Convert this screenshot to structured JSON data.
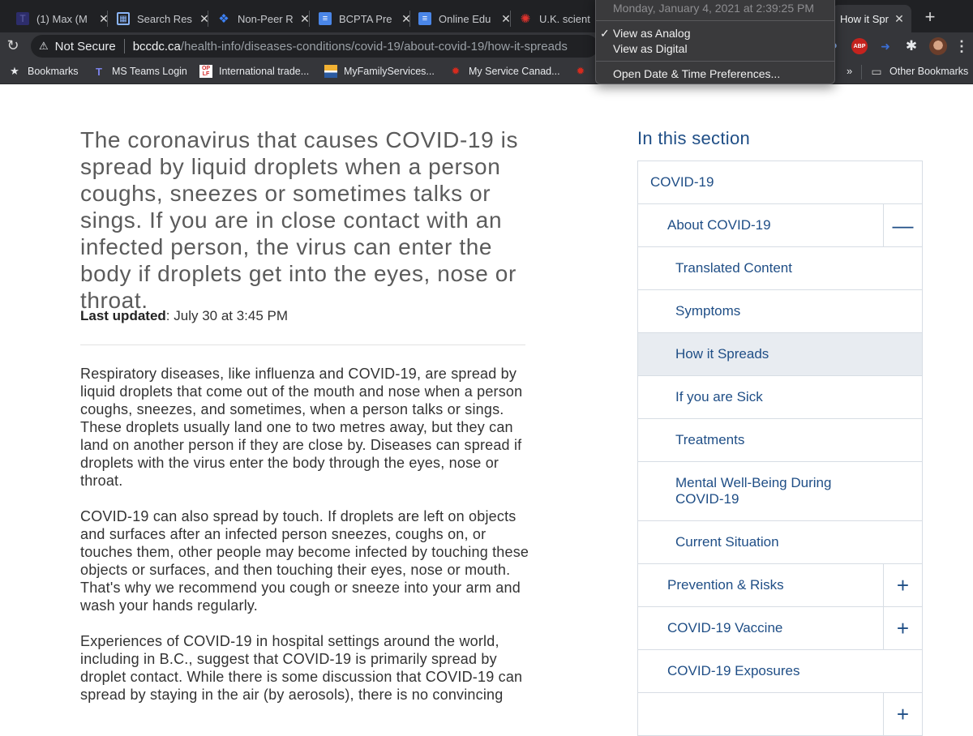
{
  "browser": {
    "tabs": [
      {
        "title": "(1) Max (M",
        "icon": "teams-icon"
      },
      {
        "title": "Search Res",
        "icon": "grid-icon"
      },
      {
        "title": "Non-Peer R",
        "icon": "dropbox-icon"
      },
      {
        "title": "BCPTA Pre",
        "icon": "docs-icon"
      },
      {
        "title": "Online Edu",
        "icon": "docs-icon"
      },
      {
        "title": "U.K. scient",
        "icon": "cbc-icon"
      },
      {
        "title": "How it Spr",
        "icon": "",
        "active": true
      }
    ],
    "new_tab": "+",
    "close": "✕",
    "reload": "↻",
    "address": {
      "security_icon": "⚠",
      "security_label": "Not Secure",
      "host": "bccdc.ca",
      "path": "/health-info/diseases-conditions/covid-19/about-covid-19/how-it-spreads"
    },
    "extensions": {
      "abp_label": "ABP",
      "menu": "⋮"
    },
    "bookmarks": [
      {
        "label": "Bookmarks",
        "icon": "star-icon"
      },
      {
        "label": "MS Teams Login",
        "icon": "teams-icon"
      },
      {
        "label": "International trade...",
        "icon": "oplf-icon"
      },
      {
        "label": "MyFamilyServices...",
        "icon": "bc-icon"
      },
      {
        "label": "My Service Canad...",
        "icon": "maple-leaf-icon"
      }
    ],
    "bookmarks_overflow": "»",
    "other_bookmarks": "Other Bookmarks"
  },
  "clock_menu": {
    "date": "Monday, January 4, 2021 at 2:39:25 PM",
    "items": [
      {
        "label": "View as Analog",
        "checked": true
      },
      {
        "label": "View as Digital",
        "checked": false
      },
      {
        "label": "Open Date & Time Preferences..."
      }
    ],
    "check": "✓"
  },
  "article": {
    "lead": "The coronavirus that causes COVID-19 is spread by liquid droplets when a person coughs, sneezes or sometimes talks or sings. If you are in close contact with an infected person, the virus can enter the body if droplets get into the eyes, nose or throat.",
    "updated_label": "Last updated",
    "updated_value": ": July 30 at 3:45 PM",
    "paragraphs": [
      "Respiratory diseases, like influenza and COVID-19, are spread by liquid droplets that come out of the mouth and nose when a person coughs, sneezes, and sometimes, when a person talks or sings. These droplets usually land one to two metres away, but they can land on another person if they are close by. Diseases can spread if droplets with the virus enter the body through the eyes, nose or throat.",
      "COVID-19 can also spread by touch. If droplets are left on objects and surfaces after an infected person sneezes, coughs on, or touches them, other people may become infected by touching these objects or surfaces, and then touching their eyes, nose or mouth. That's why we recommend you cough or sneeze into your arm and wash your hands regularly.",
      "Experiences of COVID-19 in hospital settings around the world, including in B.C., suggest that COVID-19 is primarily spread by droplet contact. While there is some discussion that COVID-19 can spread by staying in the air (by aerosols), there is no convincing"
    ]
  },
  "sidebar": {
    "title": "In this section",
    "items": [
      {
        "label": "COVID-19",
        "level": 0
      },
      {
        "label": "About COVID-19",
        "level": 1,
        "toggle": "—"
      },
      {
        "label": "Translated Content",
        "level": 2
      },
      {
        "label": "Symptoms",
        "level": 2
      },
      {
        "label": "How it Spreads",
        "level": 2,
        "active": true
      },
      {
        "label": "If you are Sick",
        "level": 2
      },
      {
        "label": "Treatments",
        "level": 2
      },
      {
        "label": "Mental Well-Being During COVID-19",
        "level": 2
      },
      {
        "label": "Current Situation",
        "level": 2
      },
      {
        "label": "Prevention & Risks",
        "level": 1,
        "toggle": "+"
      },
      {
        "label": "COVID-19 Vaccine",
        "level": 1,
        "toggle": "+"
      },
      {
        "label": "COVID-19 Exposures",
        "level": 1
      },
      {
        "label": "",
        "level": 1,
        "toggle": "+"
      }
    ]
  }
}
